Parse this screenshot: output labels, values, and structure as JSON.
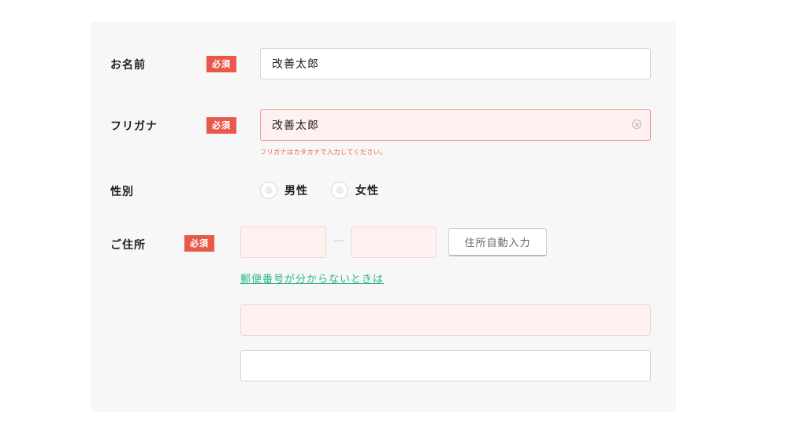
{
  "form": {
    "name": {
      "label": "お名前",
      "required": "必須",
      "value": "改善太郎"
    },
    "furigana": {
      "label": "フリガナ",
      "required": "必須",
      "value": "改善太郎",
      "error": "フリガナはカタカナで入力してください。"
    },
    "gender": {
      "label": "性別",
      "options": [
        "男性",
        "女性"
      ]
    },
    "address": {
      "label": "ご住所",
      "required": "必須",
      "dash": "—",
      "auto_button": "住所自動入力",
      "postal_link": "郵便番号が分からないときは"
    }
  },
  "colors": {
    "required_badge": "#e9594b",
    "link": "#2bb58a",
    "error_bg": "#fef1ef"
  }
}
